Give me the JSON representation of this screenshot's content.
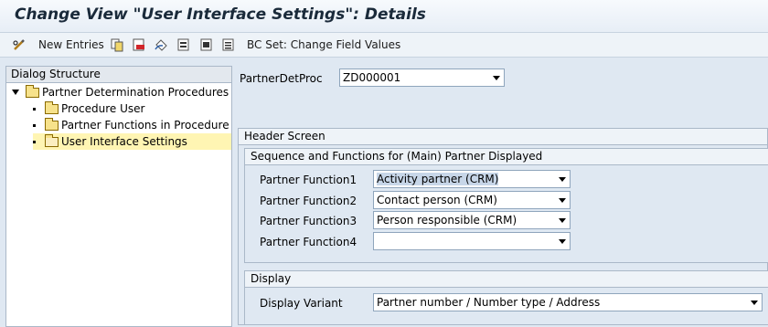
{
  "window": {
    "title": "Change View \"User Interface Settings\": Details"
  },
  "toolbar": {
    "new_entries_label": "New Entries",
    "bc_set_label": "BC Set: Change Field Values",
    "icons": [
      "glasses-pencil-icon",
      "copy-icon",
      "delete-icon",
      "undo-icon",
      "select-all-icon",
      "select-block-icon",
      "deselect-icon"
    ]
  },
  "dialog": {
    "header": "Dialog Structure",
    "items": [
      {
        "label": "Partner Determination Procedures",
        "level": 0,
        "expanded": true
      },
      {
        "label": "Procedure User",
        "level": 1
      },
      {
        "label": "Partner Functions in Procedure",
        "level": 1
      },
      {
        "label": "User Interface Settings",
        "level": 1,
        "selected": true
      }
    ]
  },
  "main": {
    "partner_det_proc": {
      "label": "PartnerDetProc",
      "value": "ZD000001"
    },
    "header_screen": {
      "title": "Header Screen",
      "sequence": {
        "title": "Sequence and Functions for (Main) Partner Displayed",
        "rows": [
          {
            "label": "Partner Function1",
            "value": "Activity partner (CRM)"
          },
          {
            "label": "Partner Function2",
            "value": "Contact person (CRM)"
          },
          {
            "label": "Partner Function3",
            "value": "Person responsible (CRM)"
          },
          {
            "label": "Partner Function4",
            "value": ""
          }
        ]
      },
      "display": {
        "title": "Display",
        "variant_label": "Display Variant",
        "variant_value": "Partner number / Number type / Address"
      }
    }
  },
  "colors": {
    "selected_row": "#fff5b3",
    "background": "#dfe8f2"
  }
}
